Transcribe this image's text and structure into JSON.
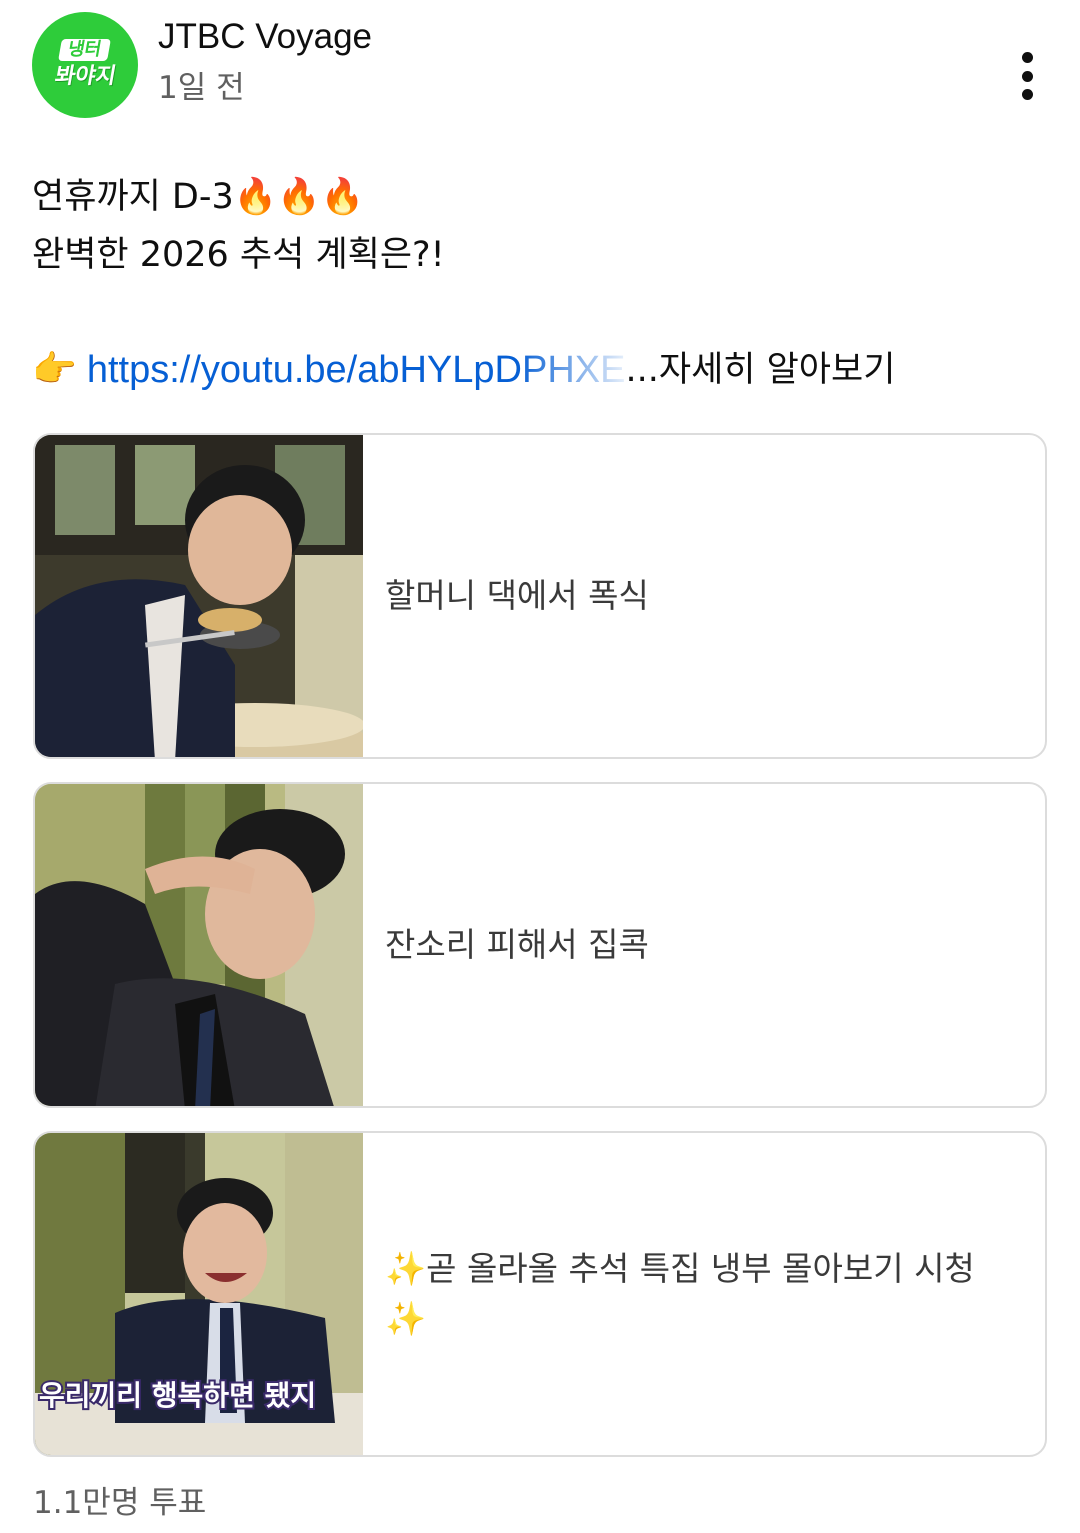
{
  "channel": {
    "name": "JTBC Voyage",
    "time": "1일 전",
    "logo_line1": "냉터",
    "logo_line2": "봐야지"
  },
  "post": {
    "line1": "연휴까지 D-3🔥🔥🔥",
    "line2": "완벽한 2026 추석 계획은?!",
    "pointer_icon": "👉",
    "link_url": "https://youtu.be/abHYLpDPHXE",
    "ellipsis": "...",
    "more_label": "자세히 알아보기"
  },
  "poll": {
    "options": [
      {
        "label": "할머니 댁에서 폭식",
        "image": "man-eating-dumpling-thumbnail"
      },
      {
        "label": "잔소리 피해서 집콕",
        "image": "man-covering-face-thumbnail"
      },
      {
        "label": "✨곧 올라올 추석 특집 냉부 몰아보기 시청✨",
        "image": "man-laughing-thumbnail",
        "image_caption": "우리끼리 행복하면 됐지"
      }
    ],
    "vote_count": "1.1만명 투표"
  },
  "colors": {
    "link": "#065fd4",
    "avatar_green": "#2ecc3a",
    "border": "#dcdcdc",
    "secondary_text": "#606060"
  }
}
